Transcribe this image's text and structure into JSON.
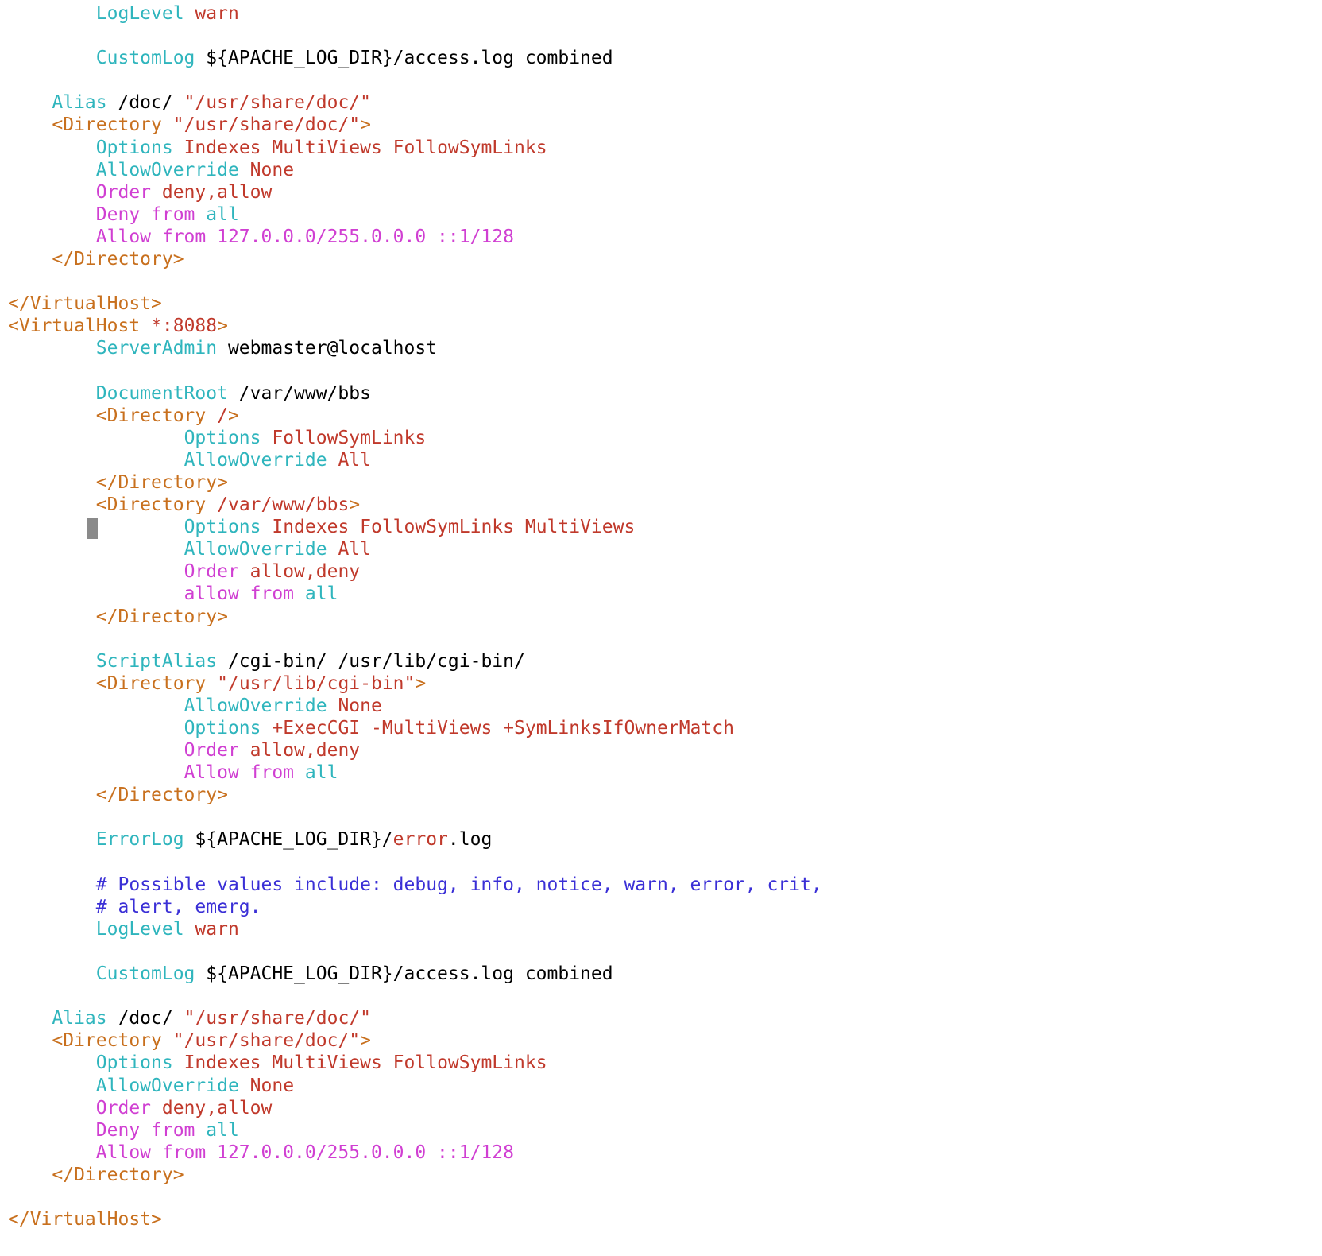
{
  "colors": {
    "plain": "#000000",
    "directive": "#2fb5bd",
    "value": "#c0392b",
    "tag": "#c8701e",
    "access": "#d03fd2",
    "comment": "#3a2fd6",
    "cursor": "#8a8a8a"
  },
  "editor": {
    "cursor_line": 23,
    "lines": [
      {
        "indent": "        ",
        "tokens": [
          {
            "t": "LogLevel",
            "c": "directive"
          },
          {
            "t": " "
          },
          {
            "t": "warn",
            "c": "value"
          }
        ]
      },
      {
        "indent": "",
        "tokens": []
      },
      {
        "indent": "        ",
        "tokens": [
          {
            "t": "CustomLog",
            "c": "directive"
          },
          {
            "t": " ${APACHE_LOG_DIR}/access.log combined"
          }
        ]
      },
      {
        "indent": "",
        "tokens": []
      },
      {
        "indent": "    ",
        "tokens": [
          {
            "t": "Alias",
            "c": "directive"
          },
          {
            "t": " /doc/ "
          },
          {
            "t": "\"/usr/share/doc/\"",
            "c": "value"
          }
        ]
      },
      {
        "indent": "    ",
        "tokens": [
          {
            "t": "<Directory",
            "c": "tag"
          },
          {
            "t": " "
          },
          {
            "t": "\"/usr/share/doc/\"",
            "c": "value"
          },
          {
            "t": ">",
            "c": "tag"
          }
        ]
      },
      {
        "indent": "        ",
        "tokens": [
          {
            "t": "Options",
            "c": "directive"
          },
          {
            "t": " "
          },
          {
            "t": "Indexes MultiViews FollowSymLinks",
            "c": "value"
          }
        ]
      },
      {
        "indent": "        ",
        "tokens": [
          {
            "t": "AllowOverride",
            "c": "directive"
          },
          {
            "t": " "
          },
          {
            "t": "None",
            "c": "value"
          }
        ]
      },
      {
        "indent": "        ",
        "tokens": [
          {
            "t": "Order",
            "c": "access"
          },
          {
            "t": " "
          },
          {
            "t": "deny,allow",
            "c": "value"
          }
        ]
      },
      {
        "indent": "        ",
        "tokens": [
          {
            "t": "Deny from",
            "c": "access"
          },
          {
            "t": " "
          },
          {
            "t": "all",
            "c": "directive"
          }
        ]
      },
      {
        "indent": "        ",
        "tokens": [
          {
            "t": "Allow from 127.0.0.0/255.0.0.0 ::1/128",
            "c": "access"
          }
        ]
      },
      {
        "indent": "    ",
        "tokens": [
          {
            "t": "</Directory>",
            "c": "tag"
          }
        ]
      },
      {
        "indent": "",
        "tokens": []
      },
      {
        "indent": "",
        "tokens": [
          {
            "t": "</VirtualHost>",
            "c": "tag"
          }
        ]
      },
      {
        "indent": "",
        "tokens": [
          {
            "t": "<VirtualHost",
            "c": "tag"
          },
          {
            "t": " "
          },
          {
            "t": "*:8088",
            "c": "value"
          },
          {
            "t": ">",
            "c": "tag"
          }
        ]
      },
      {
        "indent": "        ",
        "tokens": [
          {
            "t": "ServerAdmin",
            "c": "directive"
          },
          {
            "t": " webmaster@localhost"
          }
        ]
      },
      {
        "indent": "",
        "tokens": []
      },
      {
        "indent": "        ",
        "tokens": [
          {
            "t": "DocumentRoot",
            "c": "directive"
          },
          {
            "t": " /var/www/bbs"
          }
        ]
      },
      {
        "indent": "        ",
        "tokens": [
          {
            "t": "<Directory",
            "c": "tag"
          },
          {
            "t": " "
          },
          {
            "t": "/",
            "c": "value"
          },
          {
            "t": ">",
            "c": "tag"
          }
        ]
      },
      {
        "indent": "                ",
        "tokens": [
          {
            "t": "Options",
            "c": "directive"
          },
          {
            "t": " "
          },
          {
            "t": "FollowSymLinks",
            "c": "value"
          }
        ]
      },
      {
        "indent": "                ",
        "tokens": [
          {
            "t": "AllowOverride",
            "c": "directive"
          },
          {
            "t": " "
          },
          {
            "t": "All",
            "c": "value"
          }
        ]
      },
      {
        "indent": "        ",
        "tokens": [
          {
            "t": "</Directory>",
            "c": "tag"
          }
        ]
      },
      {
        "indent": "        ",
        "tokens": [
          {
            "t": "<Directory",
            "c": "tag"
          },
          {
            "t": " "
          },
          {
            "t": "/var/www/bbs",
            "c": "value"
          },
          {
            "t": ">",
            "c": "tag"
          }
        ]
      },
      {
        "indent": "                ",
        "tokens": [
          {
            "t": "Options",
            "c": "directive"
          },
          {
            "t": " "
          },
          {
            "t": "Indexes FollowSymLinks MultiViews",
            "c": "value"
          }
        ]
      },
      {
        "indent": "                ",
        "tokens": [
          {
            "t": "AllowOverride",
            "c": "directive"
          },
          {
            "t": " "
          },
          {
            "t": "All",
            "c": "value"
          }
        ]
      },
      {
        "indent": "                ",
        "tokens": [
          {
            "t": "Order",
            "c": "access"
          },
          {
            "t": " "
          },
          {
            "t": "allow,deny",
            "c": "value"
          }
        ]
      },
      {
        "indent": "                ",
        "tokens": [
          {
            "t": "allow from",
            "c": "access"
          },
          {
            "t": " "
          },
          {
            "t": "all",
            "c": "directive"
          }
        ]
      },
      {
        "indent": "        ",
        "tokens": [
          {
            "t": "</Directory>",
            "c": "tag"
          }
        ]
      },
      {
        "indent": "",
        "tokens": []
      },
      {
        "indent": "        ",
        "tokens": [
          {
            "t": "ScriptAlias",
            "c": "directive"
          },
          {
            "t": " /cgi-bin/ /usr/lib/cgi-bin/"
          }
        ]
      },
      {
        "indent": "        ",
        "tokens": [
          {
            "t": "<Directory",
            "c": "tag"
          },
          {
            "t": " "
          },
          {
            "t": "\"/usr/lib/cgi-bin\"",
            "c": "value"
          },
          {
            "t": ">",
            "c": "tag"
          }
        ]
      },
      {
        "indent": "                ",
        "tokens": [
          {
            "t": "AllowOverride",
            "c": "directive"
          },
          {
            "t": " "
          },
          {
            "t": "None",
            "c": "value"
          }
        ]
      },
      {
        "indent": "                ",
        "tokens": [
          {
            "t": "Options",
            "c": "directive"
          },
          {
            "t": " "
          },
          {
            "t": "+ExecCGI -MultiViews +SymLinksIfOwnerMatch",
            "c": "value"
          }
        ]
      },
      {
        "indent": "                ",
        "tokens": [
          {
            "t": "Order",
            "c": "access"
          },
          {
            "t": " "
          },
          {
            "t": "allow,deny",
            "c": "value"
          }
        ]
      },
      {
        "indent": "                ",
        "tokens": [
          {
            "t": "Allow from",
            "c": "access"
          },
          {
            "t": " "
          },
          {
            "t": "all",
            "c": "directive"
          }
        ]
      },
      {
        "indent": "        ",
        "tokens": [
          {
            "t": "</Directory>",
            "c": "tag"
          }
        ]
      },
      {
        "indent": "",
        "tokens": []
      },
      {
        "indent": "        ",
        "tokens": [
          {
            "t": "ErrorLog",
            "c": "directive"
          },
          {
            "t": " ${APACHE_LOG_DIR}/"
          },
          {
            "t": "error",
            "c": "value"
          },
          {
            "t": ".log"
          }
        ]
      },
      {
        "indent": "",
        "tokens": []
      },
      {
        "indent": "        ",
        "tokens": [
          {
            "t": "# Possible values include: debug, info, notice, warn, error, crit,",
            "c": "comment"
          }
        ]
      },
      {
        "indent": "        ",
        "tokens": [
          {
            "t": "# alert, emerg.",
            "c": "comment"
          }
        ]
      },
      {
        "indent": "        ",
        "tokens": [
          {
            "t": "LogLevel",
            "c": "directive"
          },
          {
            "t": " "
          },
          {
            "t": "warn",
            "c": "value"
          }
        ]
      },
      {
        "indent": "",
        "tokens": []
      },
      {
        "indent": "        ",
        "tokens": [
          {
            "t": "CustomLog",
            "c": "directive"
          },
          {
            "t": " ${APACHE_LOG_DIR}/access.log combined"
          }
        ]
      },
      {
        "indent": "",
        "tokens": []
      },
      {
        "indent": "    ",
        "tokens": [
          {
            "t": "Alias",
            "c": "directive"
          },
          {
            "t": " /doc/ "
          },
          {
            "t": "\"/usr/share/doc/\"",
            "c": "value"
          }
        ]
      },
      {
        "indent": "    ",
        "tokens": [
          {
            "t": "<Directory",
            "c": "tag"
          },
          {
            "t": " "
          },
          {
            "t": "\"/usr/share/doc/\"",
            "c": "value"
          },
          {
            "t": ">",
            "c": "tag"
          }
        ]
      },
      {
        "indent": "        ",
        "tokens": [
          {
            "t": "Options",
            "c": "directive"
          },
          {
            "t": " "
          },
          {
            "t": "Indexes MultiViews FollowSymLinks",
            "c": "value"
          }
        ]
      },
      {
        "indent": "        ",
        "tokens": [
          {
            "t": "AllowOverride",
            "c": "directive"
          },
          {
            "t": " "
          },
          {
            "t": "None",
            "c": "value"
          }
        ]
      },
      {
        "indent": "        ",
        "tokens": [
          {
            "t": "Order",
            "c": "access"
          },
          {
            "t": " "
          },
          {
            "t": "deny,allow",
            "c": "value"
          }
        ]
      },
      {
        "indent": "        ",
        "tokens": [
          {
            "t": "Deny from",
            "c": "access"
          },
          {
            "t": " "
          },
          {
            "t": "all",
            "c": "directive"
          }
        ]
      },
      {
        "indent": "        ",
        "tokens": [
          {
            "t": "Allow from 127.0.0.0/255.0.0.0 ::1/128",
            "c": "access"
          }
        ]
      },
      {
        "indent": "    ",
        "tokens": [
          {
            "t": "</Directory>",
            "c": "tag"
          }
        ]
      },
      {
        "indent": "",
        "tokens": []
      },
      {
        "indent": "",
        "tokens": [
          {
            "t": "</VirtualHost>",
            "c": "tag"
          }
        ]
      }
    ]
  }
}
